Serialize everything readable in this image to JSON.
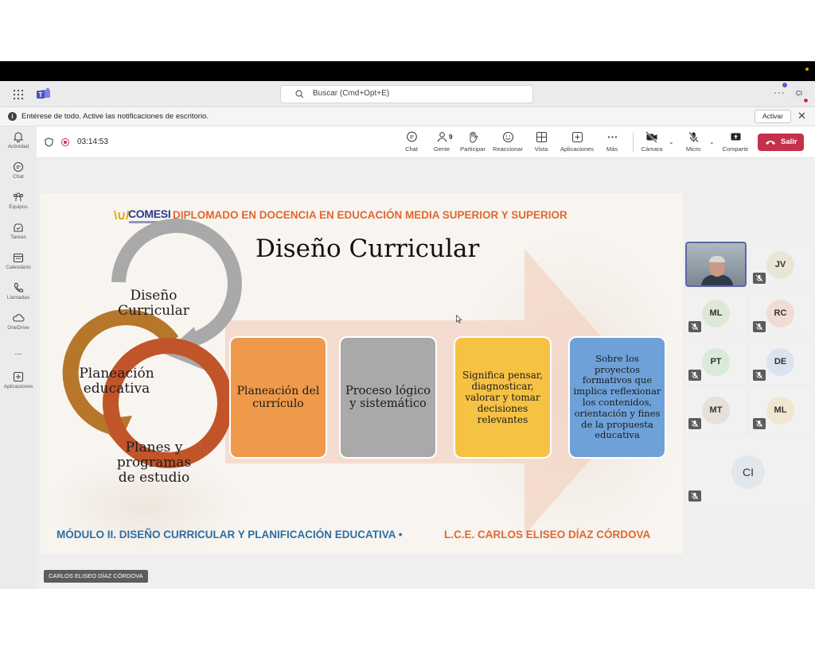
{
  "titlebar": {
    "search_placeholder": "Buscar (Cmd+Opt+E)",
    "profile_initials": "CI"
  },
  "notification": {
    "message": "Entérese de todo. Active las notificaciones de escritorio.",
    "action_label": "Activar"
  },
  "rail": {
    "items": [
      {
        "label": "Actividad",
        "icon": "bell-icon"
      },
      {
        "label": "Chat",
        "icon": "chat-icon"
      },
      {
        "label": "Equipos",
        "icon": "teams-icon"
      },
      {
        "label": "Tareas",
        "icon": "tasks-icon"
      },
      {
        "label": "Calendario",
        "icon": "calendar-icon"
      },
      {
        "label": "Llamadas",
        "icon": "phone-icon"
      },
      {
        "label": "OneDrive",
        "icon": "cloud-icon"
      },
      {
        "label": "Aplicaciones",
        "icon": "add-app-icon"
      }
    ],
    "more": "..."
  },
  "meeting": {
    "timer": "03:14:53",
    "tools": {
      "chat": "Chat",
      "people": "Gente",
      "people_count": "9",
      "raise": "Participar",
      "react": "Reaccionar",
      "view": "Vista",
      "apps": "Aplicaciones",
      "more": "Más",
      "camera": "Cámara",
      "mic": "Micro",
      "share": "Compartir",
      "leave": "Salir"
    }
  },
  "slide": {
    "logo_text": "COMESI",
    "header": "DIPLOMADO EN DOCENCIA EN EDUCACIÓN MEDIA SUPERIOR Y SUPERIOR",
    "title": "Diseño Curricular",
    "cycle": {
      "first": [
        "Diseño",
        "Curricular"
      ],
      "second": [
        "Planeación",
        "educativa"
      ],
      "third": [
        "Planes y",
        "programas",
        "de estudio"
      ]
    },
    "boxes": [
      {
        "text": "Planeación del currículo",
        "color": "#ef9a4a"
      },
      {
        "text": "Proceso lógico y sistemático",
        "color": "#a9a9a9"
      },
      {
        "text": "Significa pensar, diagnosticar, valorar y tomar decisiones relevantes",
        "color": "#f6c244"
      },
      {
        "text": "Sobre los proyectos formativos que implica reflexionar los contenidos, orientación y fines de la propuesta educativa",
        "color": "#6fa1d9"
      }
    ],
    "footer_left": "MÓDULO II. DISEÑO CURRICULAR Y PLANIFICACIÓN EDUCATIVA •",
    "footer_right": "L.C.E. CARLOS ELISEO DÍAZ CÓRDOVA"
  },
  "presenter_name": "CARLOS ELISEO DÍAZ CÓRDOVA",
  "participants": [
    {
      "initials": "JV",
      "color": "#e9e6d6"
    },
    {
      "initials": "ML",
      "color": "#dfe8d6"
    },
    {
      "initials": "RC",
      "color": "#f1dcd3"
    },
    {
      "initials": "PT",
      "color": "#d9ead9"
    },
    {
      "initials": "DE",
      "color": "#dbe3f1"
    },
    {
      "initials": "MT",
      "color": "#e6e0da"
    },
    {
      "initials": "ML",
      "color": "#f1e6cf"
    },
    {
      "initials": "CI",
      "color": "#e1e7ed"
    }
  ],
  "colors": {
    "accent": "#6264a7",
    "leave": "#c4314b",
    "header_orange": "#e2672c",
    "footer_blue": "#2d6fa3"
  }
}
